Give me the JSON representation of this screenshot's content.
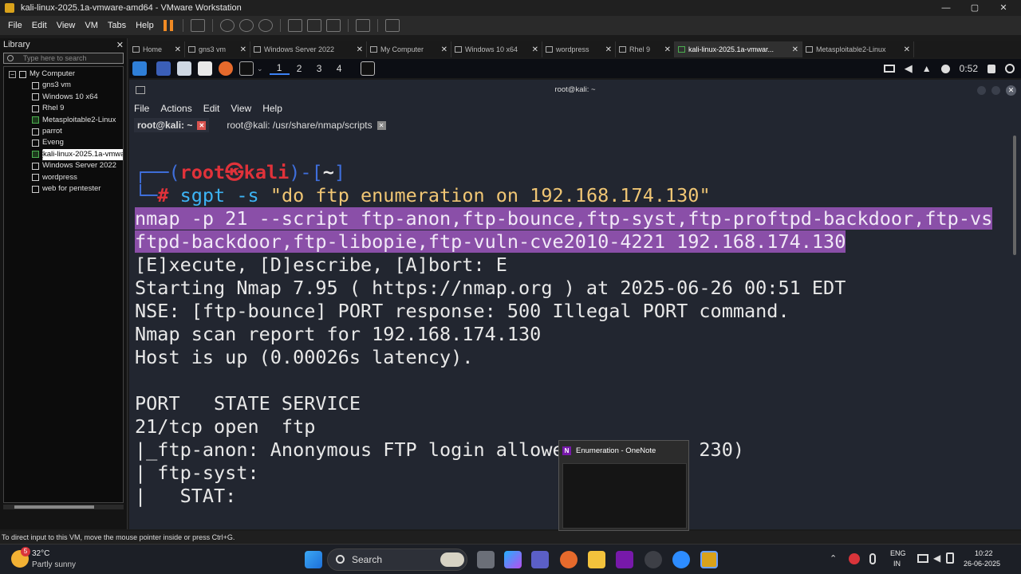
{
  "window": {
    "title": "kali-linux-2025.1a-vmware-amd64 - VMware Workstation",
    "minimize": "—",
    "maximize": "▢",
    "close": "✕"
  },
  "menubar": [
    "File",
    "Edit",
    "View",
    "VM",
    "Tabs",
    "Help"
  ],
  "library": {
    "title": "Library",
    "close": "✕",
    "search_placeholder": "Type here to search",
    "root": "My Computer",
    "items": [
      "gns3 vm",
      "Windows 10 x64",
      "Rhel 9",
      "Metasploitable2-Linux",
      "parrot",
      "Eveng",
      "kali-linux-2025.1a-vmwa",
      "Windows Server 2022",
      "wordpress",
      "web for pentester"
    ]
  },
  "vm_tabs": [
    {
      "label": "Home"
    },
    {
      "label": "gns3 vm"
    },
    {
      "label": "Windows Server 2022"
    },
    {
      "label": "My Computer"
    },
    {
      "label": "Windows 10 x64"
    },
    {
      "label": "wordpress"
    },
    {
      "label": "Rhel 9"
    },
    {
      "label": "kali-linux-2025.1a-vmwar..."
    },
    {
      "label": "Metasploitable2-Linux"
    }
  ],
  "kali_panel": {
    "workspaces": [
      "1",
      "2",
      "3",
      "4"
    ],
    "time": "0:52"
  },
  "terminal": {
    "title": "root@kali: ~",
    "menu": [
      "File",
      "Actions",
      "Edit",
      "View",
      "Help"
    ],
    "tabs": [
      "root@kali: ~",
      "root@kali: /usr/share/nmap/scripts"
    ],
    "prompt": {
      "open": "┌──(",
      "user": "root㉿kali",
      "close": ")-[",
      "dir": "~",
      "end": "]",
      "hash_prefix": "└─",
      "hash": "#"
    },
    "command": {
      "name": "sgpt",
      "flag": "-s",
      "arg": "\"do ftp enumeration on 192.168.174.130\""
    },
    "hl1": "nmap -p 21 --script ftp-anon,ftp-bounce,ftp-syst,ftp-proftpd-backdoor,ftp-vs",
    "hl2": "ftpd-backdoor,ftp-libopie,ftp-vuln-cve2010-4221 192.168.174.130",
    "output": [
      "[E]xecute, [D]escribe, [A]bort: E",
      "Starting Nmap 7.95 ( https://nmap.org ) at 2025-06-26 00:51 EDT",
      "NSE: [ftp-bounce] PORT response: 500 Illegal PORT command.",
      "Nmap scan report for 192.168.174.130",
      "Host is up (0.00026s latency).",
      "",
      "PORT   STATE SERVICE",
      "21/tcp open  ftp",
      "|_ftp-anon: Anonymous FTP login allowed (FTP code 230)",
      "| ftp-syst:",
      "|   STAT:"
    ]
  },
  "onenote": {
    "title": "Enumeration - OneNote",
    "icon": "N"
  },
  "statusbar": "To direct input to this VM, move the mouse pointer inside or press Ctrl+G.",
  "taskbar": {
    "weather_temp": "32°C",
    "weather_desc": "Partly sunny",
    "weather_badge": "5",
    "search": "Search",
    "lang1": "ENG",
    "lang2": "IN",
    "time": "10:22",
    "date": "26-06-2025"
  }
}
